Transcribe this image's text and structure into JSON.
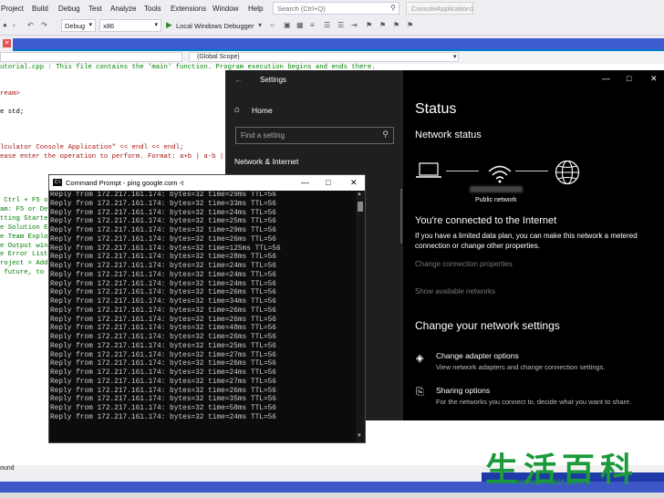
{
  "menu": [
    "Project",
    "Build",
    "Debug",
    "Test",
    "Analyze",
    "Tools",
    "Extensions",
    "Window",
    "Help"
  ],
  "search": {
    "placeholder": "Search (Ctrl+Q)"
  },
  "solution_name": "ConsoleApplication1",
  "toolbar": {
    "config": "Debug",
    "platform": "x86",
    "debugger": "Local Windows Debugger"
  },
  "navbar": {
    "scope": "(Global Scope)"
  },
  "editor": {
    "lines": [
      {
        "text": "utorial.cpp : This file contains the 'main' function. Program execution begins and ends there.",
        "cls": "c-green"
      },
      {
        "text": "ream>",
        "cls": "c-red"
      },
      {
        "text": "e std;",
        "cls": "c-black"
      },
      {
        "text": "lculator Console Application\" << endl << endl;",
        "cls": "c-red"
      },
      {
        "text": "ease enter the operation to perform. Format: a+b | a-b | a",
        "cls": "c-red"
      },
      {
        "text": " Ctrl + F5 o",
        "cls": "c-green"
      },
      {
        "text": "am: F5 or Deb",
        "cls": "c-green"
      },
      {
        "text": "tting Started",
        "cls": "c-green"
      },
      {
        "text": "e Solution Ex",
        "cls": "c-green"
      },
      {
        "text": "e Team Explor",
        "cls": "c-green"
      },
      {
        "text": "e Output wind",
        "cls": "c-green"
      },
      {
        "text": "e Error List",
        "cls": "c-green"
      },
      {
        "text": "roject > Add",
        "cls": "c-green"
      },
      {
        "text": " future, to o",
        "cls": "c-green"
      }
    ],
    "bottom_label": "ound"
  },
  "settings": {
    "title": "Settings",
    "home": "Home",
    "find_placeholder": "Find a setting",
    "section": "Network & Internet",
    "status_heading": "Status",
    "network_status": "Network status",
    "public_network": "Public network",
    "connected": "You're connected to the Internet",
    "limited_plan": "If you have a limited data plan, you can make this network a metered connection or change other properties.",
    "change_connection": "Change connection properties",
    "show_available": "Show available networks",
    "change_heading": "Change your network settings",
    "adapter_title": "Change adapter options",
    "adapter_desc": "View network adapters and change connection settings.",
    "sharing_title": "Sharing options",
    "sharing_desc": "For the networks you connect to, decide what you want to share."
  },
  "cmd": {
    "title": "Command Prompt - ping  google.com -t",
    "lines": [
      "Reply from 172.217.161.174: bytes=32 time=29ms TTL=56",
      "Reply from 172.217.161.174: bytes=32 time=33ms TTL=56",
      "Reply from 172.217.161.174: bytes=32 time=24ms TTL=56",
      "Reply from 172.217.161.174: bytes=32 time=25ms TTL=56",
      "Reply from 172.217.161.174: bytes=32 time=29ms TTL=56",
      "Reply from 172.217.161.174: bytes=32 time=26ms TTL=56",
      "Reply from 172.217.161.174: bytes=32 time=125ms TTL=56",
      "Reply from 172.217.161.174: bytes=32 time=28ms TTL=56",
      "Reply from 172.217.161.174: bytes=32 time=24ms TTL=56",
      "Reply from 172.217.161.174: bytes=32 time=24ms TTL=56",
      "Reply from 172.217.161.174: bytes=32 time=24ms TTL=56",
      "Reply from 172.217.161.174: bytes=32 time=26ms TTL=56",
      "Reply from 172.217.161.174: bytes=32 time=34ms TTL=56",
      "Reply from 172.217.161.174: bytes=32 time=26ms TTL=56",
      "Reply from 172.217.161.174: bytes=32 time=26ms TTL=56",
      "Reply from 172.217.161.174: bytes=32 time=48ms TTL=56",
      "Reply from 172.217.161.174: bytes=32 time=26ms TTL=56",
      "Reply from 172.217.161.174: bytes=32 time=25ms TTL=56",
      "Reply from 172.217.161.174: bytes=32 time=27ms TTL=56",
      "Reply from 172.217.161.174: bytes=32 time=26ms TTL=56",
      "Reply from 172.217.161.174: bytes=32 time=24ms TTL=56",
      "Reply from 172.217.161.174: bytes=32 time=27ms TTL=56",
      "Reply from 172.217.161.174: bytes=32 time=26ms TTL=56",
      "Reply from 172.217.161.174: bytes=32 time=35ms TTL=56",
      "Reply from 172.217.161.174: bytes=32 time=58ms TTL=56",
      "Reply from 172.217.161.174: bytes=32 time=24ms TTL=56"
    ]
  },
  "watermark": {
    "text": "生活百科",
    "url": "www.bimeiz.com"
  },
  "colors": {
    "vs_accent": "#007acc",
    "status_bar": "#1f3aa8",
    "watermark": "#1a9a3a"
  }
}
